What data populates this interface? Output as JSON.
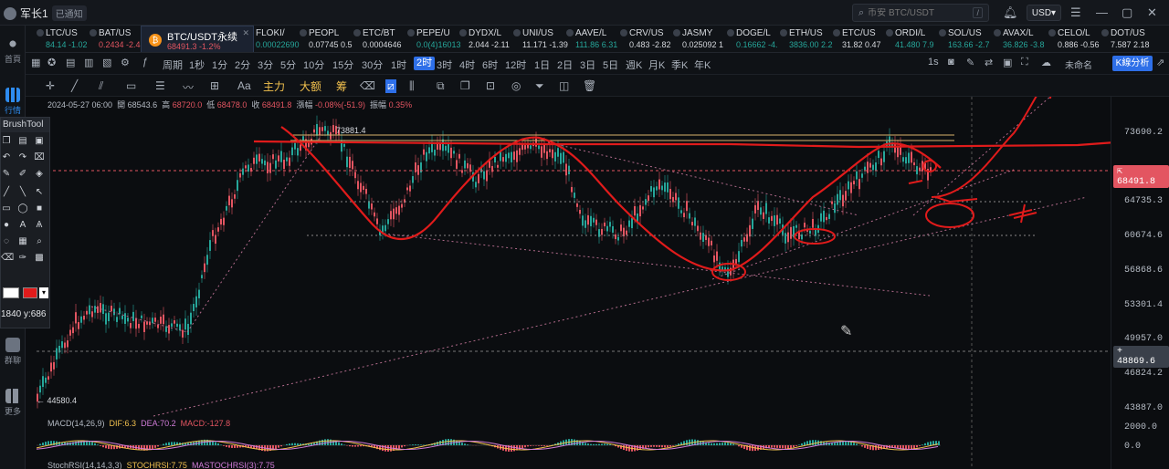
{
  "user": {
    "name": "军长1",
    "badge": "已通知"
  },
  "search": {
    "placeholder": "币安 BTC/USDT",
    "shortcut": "/"
  },
  "currency": "USD",
  "sidebar": {
    "home": "首頁",
    "market": "行情",
    "group": "群聊",
    "more": "更多"
  },
  "tickers": [
    {
      "name": "LTC/US",
      "price": "84.14 -1.02",
      "color": "#26a69a"
    },
    {
      "name": "BAT/US",
      "price": "0.2434 -2.48",
      "color": "#e35561"
    },
    {
      "name": "FLOKI/",
      "price": "0.00022690",
      "color": "#26a69a"
    },
    {
      "name": "PEOPL",
      "price": "0.07745 0.5",
      "color": "#d6d9de"
    },
    {
      "name": "ETC/BT",
      "price": "0.0004646",
      "color": "#d6d9de"
    },
    {
      "name": "PEPE/U",
      "price": "0.0(4)16013",
      "color": "#26a69a"
    },
    {
      "name": "DYDX/L",
      "price": "2.044 -2.11",
      "color": "#d6d9de"
    },
    {
      "name": "UNI/US",
      "price": "11.171 -1.39",
      "color": "#d6d9de"
    },
    {
      "name": "AAVE/L",
      "price": "111.86 6.31",
      "color": "#26a69a"
    },
    {
      "name": "CRV/US",
      "price": "0.483 -2.82",
      "color": "#d6d9de"
    },
    {
      "name": "JASMY",
      "price": "0.025092 1",
      "color": "#d6d9de"
    },
    {
      "name": "DOGE/L",
      "price": "0.16662 -4.",
      "color": "#26a69a"
    },
    {
      "name": "ETH/US",
      "price": "3836.00 2.2",
      "color": "#26a69a"
    },
    {
      "name": "ETC/US",
      "price": "31.82 0.47",
      "color": "#d6d9de"
    },
    {
      "name": "ORDI/L",
      "price": "41.480 7.9",
      "color": "#26a69a"
    },
    {
      "name": "SOL/US",
      "price": "163.66 -2.7",
      "color": "#26a69a"
    },
    {
      "name": "AVAX/L",
      "price": "36.826 -3.8",
      "color": "#26a69a"
    },
    {
      "name": "CELO/L",
      "price": "0.886 -0.56",
      "color": "#d6d9de"
    },
    {
      "name": "DOT/US",
      "price": "7.587 2.18",
      "color": "#d6d9de"
    }
  ],
  "active_ticker": {
    "name": "BTC/USDT永续",
    "price": "68491.3 -1.2%"
  },
  "periods": [
    "周期",
    "1秒",
    "1分",
    "2分",
    "3分",
    "5分",
    "10分",
    "15分",
    "30分",
    "1时",
    "2时",
    "3时",
    "4时",
    "6时",
    "12时",
    "1日",
    "2日",
    "3日",
    "5日",
    "週K",
    "月K",
    "季K",
    "年K"
  ],
  "active_period": "2时",
  "toolbar_right": {
    "interval": "1s",
    "unnamed": "未命名",
    "kline": "K線分析"
  },
  "draw_tools": {
    "text": "Aa",
    "main": "主力",
    "big": "大额",
    "chip": "筹"
  },
  "info": {
    "date": "2024-05-27 06:00",
    "open_label": "開",
    "open": "68543.6",
    "high_label": "高",
    "high": "68720.0",
    "low_label": "低",
    "low": "68478.0",
    "close_label": "收",
    "close": "68491.8",
    "chg_label": "漲幅",
    "chg": "-0.08%(-51.9)",
    "amp_label": "振幅",
    "amp": "0.35%"
  },
  "chart_labels": {
    "high": "73881.4",
    "low": "← 44580.4"
  },
  "price_axis": [
    "73690.2",
    "64735.3",
    "60674.6",
    "56868.6",
    "53301.4",
    "49957.0",
    "46824.2",
    "43887.0",
    "2000.0",
    "0.0"
  ],
  "price_tags": {
    "current": "68491.8",
    "cross": "48869.6"
  },
  "brush": {
    "title": "BrushTool",
    "coord": "1840 y:686"
  },
  "macd": {
    "label": "MACD(14,26,9)",
    "dif": "DIF:6.3",
    "dea": "DEA:70.2",
    "macd": "MACD:-127.8"
  },
  "stoch": {
    "label": "StochRSI(14,14,3,3)",
    "k": "STOCHRSI:7.75",
    "d": "MASTOCHRSI(3):7.75"
  }
}
